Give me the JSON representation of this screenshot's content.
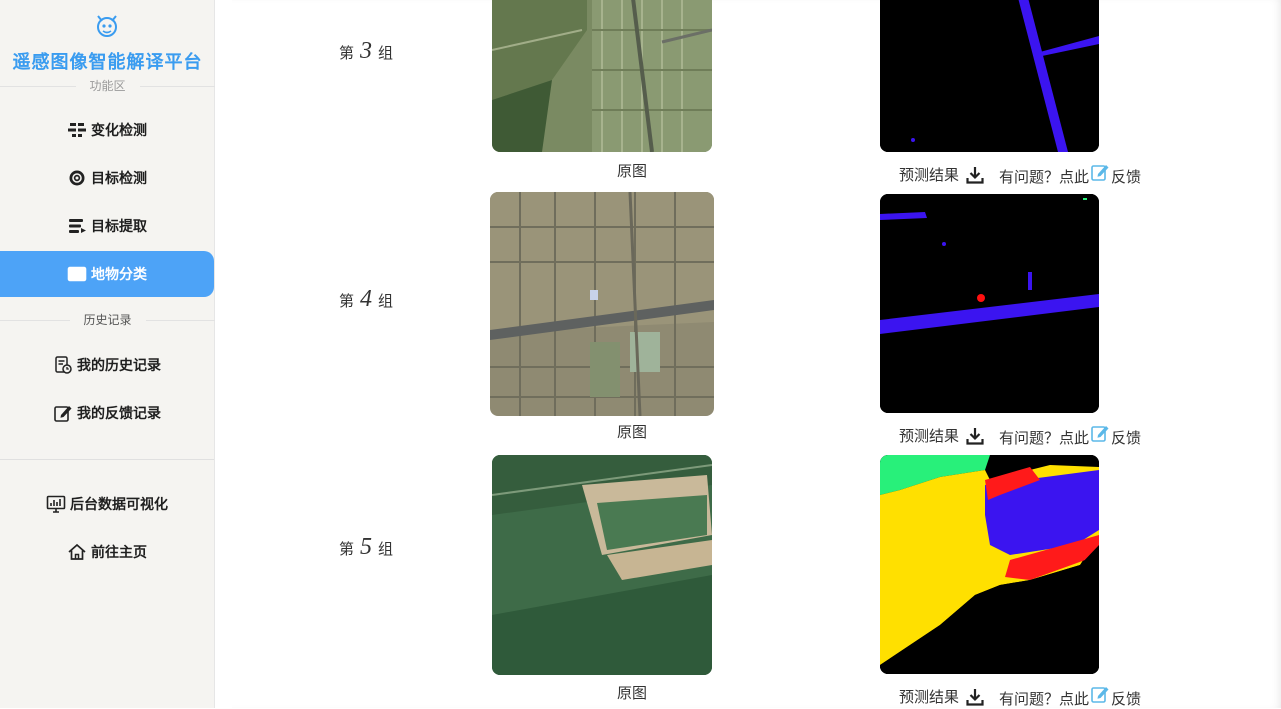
{
  "sidebar": {
    "title": "遥感图像智能解译平台",
    "section_function": "功能区",
    "section_history": "历史记录",
    "items": [
      {
        "label": "变化检测",
        "icon": "change-detect-icon"
      },
      {
        "label": "目标检测",
        "icon": "target-detect-icon"
      },
      {
        "label": "目标提取",
        "icon": "target-extract-icon"
      },
      {
        "label": "地物分类",
        "icon": "classify-icon",
        "active": true
      }
    ],
    "history_items": [
      {
        "label": "我的历史记录",
        "icon": "history-icon"
      },
      {
        "label": "我的反馈记录",
        "icon": "feedback-edit-icon"
      }
    ],
    "bottom_items": [
      {
        "label": "后台数据可视化",
        "icon": "monitor-chart-icon"
      },
      {
        "label": "前往主页",
        "icon": "home-icon"
      }
    ]
  },
  "groups": [
    {
      "prefix": "第",
      "number": "3",
      "suffix": "组",
      "original_caption": "原图",
      "result_label": "预测结果",
      "feedback_prefix": "有问题？点此",
      "feedback_suffix": "反馈"
    },
    {
      "prefix": "第",
      "number": "4",
      "suffix": "组",
      "original_caption": "原图",
      "result_label": "预测结果",
      "feedback_prefix": "有问题？点此",
      "feedback_suffix": "反馈"
    },
    {
      "prefix": "第",
      "number": "5",
      "suffix": "组",
      "original_caption": "原图",
      "result_label": "预测结果",
      "feedback_prefix": "有问题？点此",
      "feedback_suffix": "反馈"
    }
  ],
  "colors": {
    "accent": "#4da3f7",
    "title": "#3a9cf0",
    "mask_road": "#3b14f0",
    "mask_building": "#ff0000",
    "mask_yellow": "#ffe000",
    "mask_green": "#28f07a",
    "mask_bg": "#000000"
  }
}
